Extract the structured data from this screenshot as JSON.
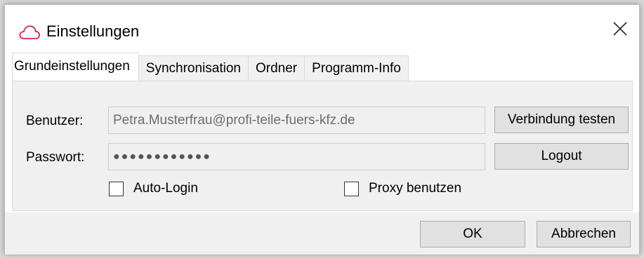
{
  "window": {
    "title": "Einstellungen",
    "close_label": "✕"
  },
  "tabs": [
    {
      "label": "Grundeinstellungen",
      "active": true
    },
    {
      "label": "Synchronisation",
      "active": false
    },
    {
      "label": "Ordner",
      "active": false
    },
    {
      "label": "Programm-Info",
      "active": false
    }
  ],
  "form": {
    "user_label": "Benutzer:",
    "user_value": "Petra.Musterfrau@profi-teile-fuers-kfz.de",
    "password_label": "Passwort:",
    "password_value": "●●●●●●●●●●●●",
    "test_connection_button": "Verbindung testen",
    "logout_button": "Logout",
    "auto_login_label": "Auto-Login",
    "auto_login_checked": false,
    "proxy_label": "Proxy benutzen",
    "proxy_checked": false
  },
  "footer": {
    "ok_button": "OK",
    "cancel_button": "Abbrechen"
  },
  "colors": {
    "cloud_icon": "#d0273a",
    "panel_bg": "#f0f0f0",
    "button_bg": "#e1e1e1"
  },
  "icons": {
    "title_icon": "cloud-icon",
    "close_icon": "close-icon"
  }
}
